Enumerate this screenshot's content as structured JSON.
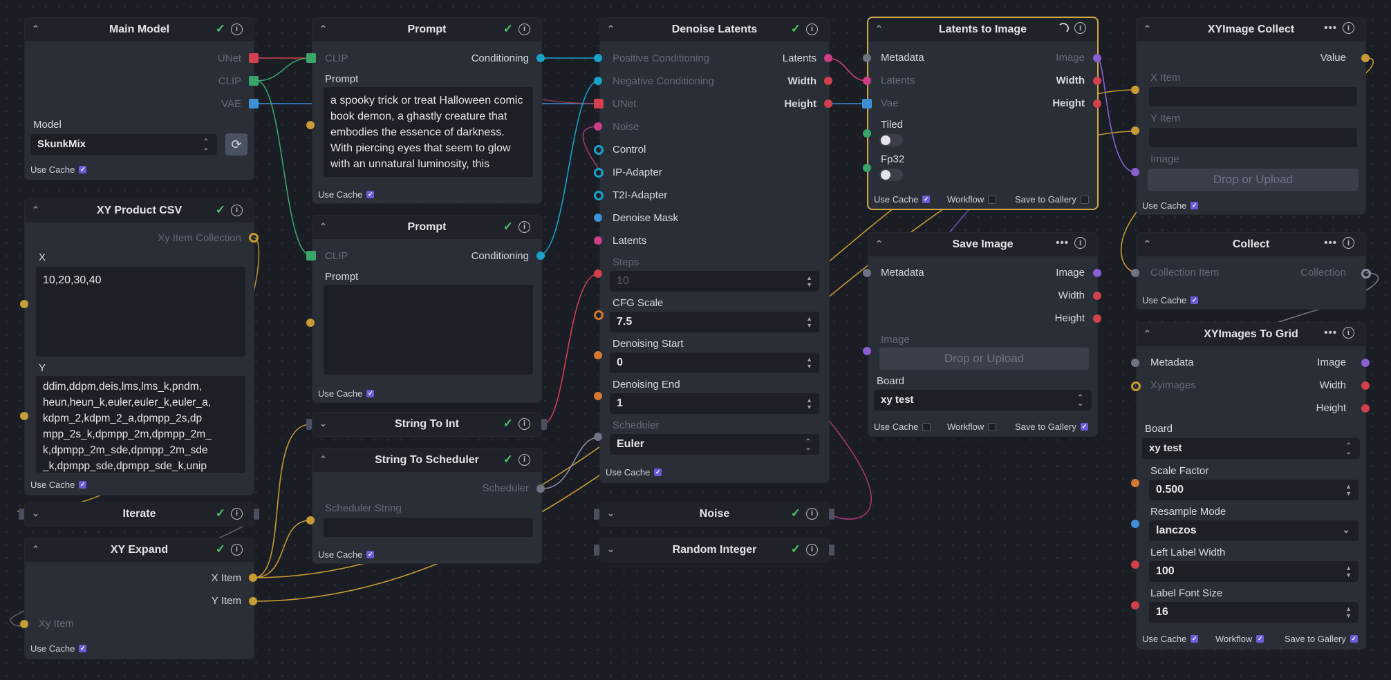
{
  "common": {
    "use_cache": "Use Cache",
    "workflow": "Workflow",
    "save_to_gallery": "Save to Gallery"
  },
  "main_model": {
    "title": "Main Model",
    "unet": "UNet",
    "clip": "CLIP",
    "vae": "VAE",
    "model_label": "Model",
    "model_value": "SkunkMix"
  },
  "prompt1": {
    "title": "Prompt",
    "clip": "CLIP",
    "conditioning": "Conditioning",
    "prompt_label": "Prompt",
    "prompt_text": "a spooky trick or treat Halloween comic book demon, a ghastly creature that embodies the essence of darkness. With piercing eyes that seem to glow with an unnatural luminosity, this"
  },
  "prompt2": {
    "title": "Prompt",
    "clip": "CLIP",
    "conditioning": "Conditioning",
    "prompt_label": "Prompt",
    "prompt_text": ""
  },
  "xy_product_csv": {
    "title": "XY Product CSV",
    "collection": "Xy Item Collection",
    "x_label": "X",
    "x_value": "10,20,30,40",
    "y_label": "Y",
    "y_value": "ddim,ddpm,deis,lms,lms_k,pndm, heun,heun_k,euler,euler_k,euler_a, kdpm_2,kdpm_2_a,dpmpp_2s,dp mpp_2s_k,dpmpp_2m,dpmpp_2m_ k,dpmpp_2m_sde,dpmpp_2m_sde _k,dpmpp_sde,dpmpp_sde_k,unip"
  },
  "iterate": {
    "title": "Iterate"
  },
  "xy_expand": {
    "title": "XY Expand",
    "x_item": "X Item",
    "y_item": "Y Item",
    "xy_item": "Xy Item"
  },
  "string_to_int": {
    "title": "String To Int"
  },
  "string_to_scheduler": {
    "title": "String To Scheduler",
    "scheduler": "Scheduler",
    "scheduler_string": "Scheduler String"
  },
  "denoise": {
    "title": "Denoise Latents",
    "pos": "Positive Conditioning",
    "neg": "Negative Conditioning",
    "unet": "UNet",
    "noise": "Noise",
    "control": "Control",
    "ip_adapter": "IP-Adapter",
    "t2i": "T2I-Adapter",
    "mask": "Denoise Mask",
    "latents_in": "Latents",
    "latents_out": "Latents",
    "width": "Width",
    "height": "Height",
    "steps_label": "Steps",
    "steps": "10",
    "cfg_label": "CFG Scale",
    "cfg": "7.5",
    "dstart_label": "Denoising Start",
    "dstart": "0",
    "dend_label": "Denoising End",
    "dend": "1",
    "sched_label": "Scheduler",
    "sched": "Euler"
  },
  "noise": {
    "title": "Noise"
  },
  "random_integer": {
    "title": "Random Integer"
  },
  "latents_to_image": {
    "title": "Latents to Image",
    "metadata": "Metadata",
    "latents": "Latents",
    "vae": "Vae",
    "tiled": "Tiled",
    "fp32": "Fp32",
    "image": "Image",
    "width": "Width",
    "height": "Height"
  },
  "save_image": {
    "title": "Save Image",
    "metadata": "Metadata",
    "image_out": "Image",
    "width": "Width",
    "height": "Height",
    "image_in": "Image",
    "drop": "Drop or Upload",
    "board_label": "Board",
    "board": "xy test"
  },
  "xyimage_collect": {
    "title": "XYImage Collect",
    "value": "Value",
    "x_item": "X Item",
    "y_item": "Y Item",
    "image": "Image",
    "drop": "Drop or Upload"
  },
  "collect": {
    "title": "Collect",
    "item": "Collection Item",
    "collection": "Collection"
  },
  "xyimages_grid": {
    "title": "XYImages To Grid",
    "metadata": "Metadata",
    "xyimages": "Xyimages",
    "image": "Image",
    "width": "Width",
    "height": "Height",
    "board_label": "Board",
    "board": "xy test",
    "scale_label": "Scale Factor",
    "scale": "0.500",
    "resample_label": "Resample Mode",
    "resample": "lanczos",
    "llw_label": "Left Label Width",
    "llw": "100",
    "lfs_label": "Label Font Size",
    "lfs": "16"
  },
  "colors": {
    "canvas": "#1a1d24",
    "node": "#2a2e37",
    "header": "#1f2229",
    "accent": "#6b5bd6",
    "selected": "#d4a74a",
    "ok": "#4fc36a"
  },
  "icons": {
    "check": "✓",
    "info": "i",
    "menu": "•••",
    "collapse": "⌃",
    "expand": "⌄",
    "refresh": "⟳",
    "spinner": "spinner-icon"
  }
}
